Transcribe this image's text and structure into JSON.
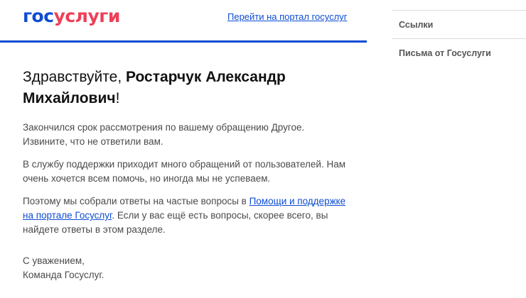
{
  "header": {
    "logo": {
      "part1": "гос",
      "part2": "услуги"
    },
    "portal_link": "Перейти на портал госуслуг"
  },
  "greeting": {
    "prefix": "Здравствуйте, ",
    "name": "Ростарчук Александр Михайлович",
    "suffix": "!"
  },
  "body": {
    "p1": "Закончился срок рассмотрения по вашему обращению Другое. Извините, что не ответили вам.",
    "p2": "В службу поддержки приходит много обращений от пользователей. Нам очень хочется всем помочь, но иногда мы не успеваем.",
    "p3_before": "Поэтому мы собрали ответы на частые вопросы в ",
    "p3_link": "Помощи и поддержке на портале Госуслуг",
    "p3_after": ". Если у вас ещё есть вопросы, скорее всего, вы найдете ответы в этом разделе."
  },
  "signature": {
    "line1": "С уважением,",
    "line2": "Команда Госуслуг."
  },
  "sidebar": {
    "items": [
      {
        "label": "Ссылки"
      },
      {
        "label": "Письма от Госуслуги"
      }
    ]
  },
  "colors": {
    "brand_blue": "#0d4cd3",
    "brand_red": "#ee3f58"
  }
}
